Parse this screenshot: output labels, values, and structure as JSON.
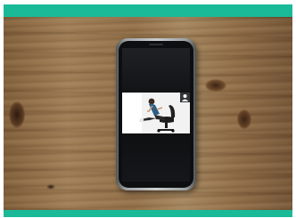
{
  "colors": {
    "accent_bar": "#1aba98",
    "phone_screen": "#121315",
    "video_background": "#f3f3f3"
  },
  "scene": {
    "background": "wooden-table",
    "device": "smartphone",
    "video_subject": "person-sitting-in-office-chair",
    "icons": [
      "user-icon"
    ]
  }
}
